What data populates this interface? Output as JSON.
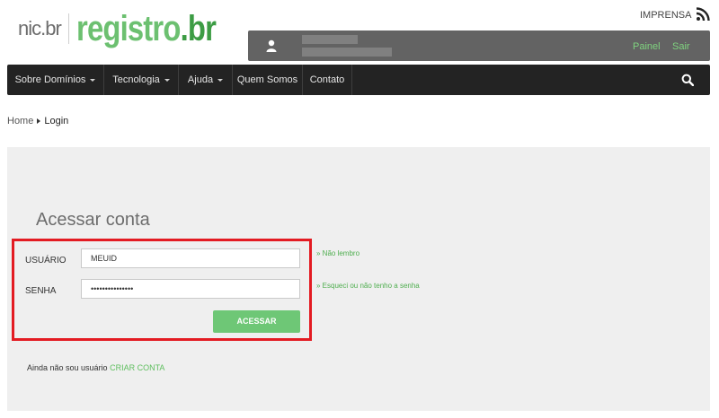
{
  "header": {
    "logo": {
      "left": "nic.br",
      "main": "registro",
      "tld": ".br"
    },
    "press_label": "IMPRENSA",
    "rss_icon": "rss-icon",
    "user_icon": "user-icon",
    "links": {
      "painel": "Painel",
      "sair": "Sair"
    }
  },
  "nav": {
    "items": [
      {
        "label": "Sobre Domínios",
        "has_caret": true
      },
      {
        "label": "Tecnologia",
        "has_caret": true
      },
      {
        "label": "Ajuda",
        "has_caret": true
      },
      {
        "label": "Quem Somos",
        "has_caret": false
      },
      {
        "label": "Contato",
        "has_caret": false
      }
    ],
    "search_icon": "search-icon"
  },
  "breadcrumb": {
    "home": "Home",
    "current": "Login"
  },
  "login": {
    "title": "Acessar conta",
    "user_label": "USUÁRIO",
    "user_value": "MEUID",
    "pass_label": "SENHA",
    "pass_value": "•••••••••••••••",
    "forgot_user": "» Não lembro",
    "forgot_pass": "» Esqueci ou não tenho a senha",
    "submit": "ACESSAR",
    "signup_text": "Ainda não sou usuário",
    "signup_link": "CRIAR CONTA"
  },
  "colors": {
    "brand_green": "#6ec776",
    "nav_bg": "#232323",
    "userbar_bg": "#636363",
    "panel_bg": "#efefef",
    "highlight": "#e31b22"
  }
}
